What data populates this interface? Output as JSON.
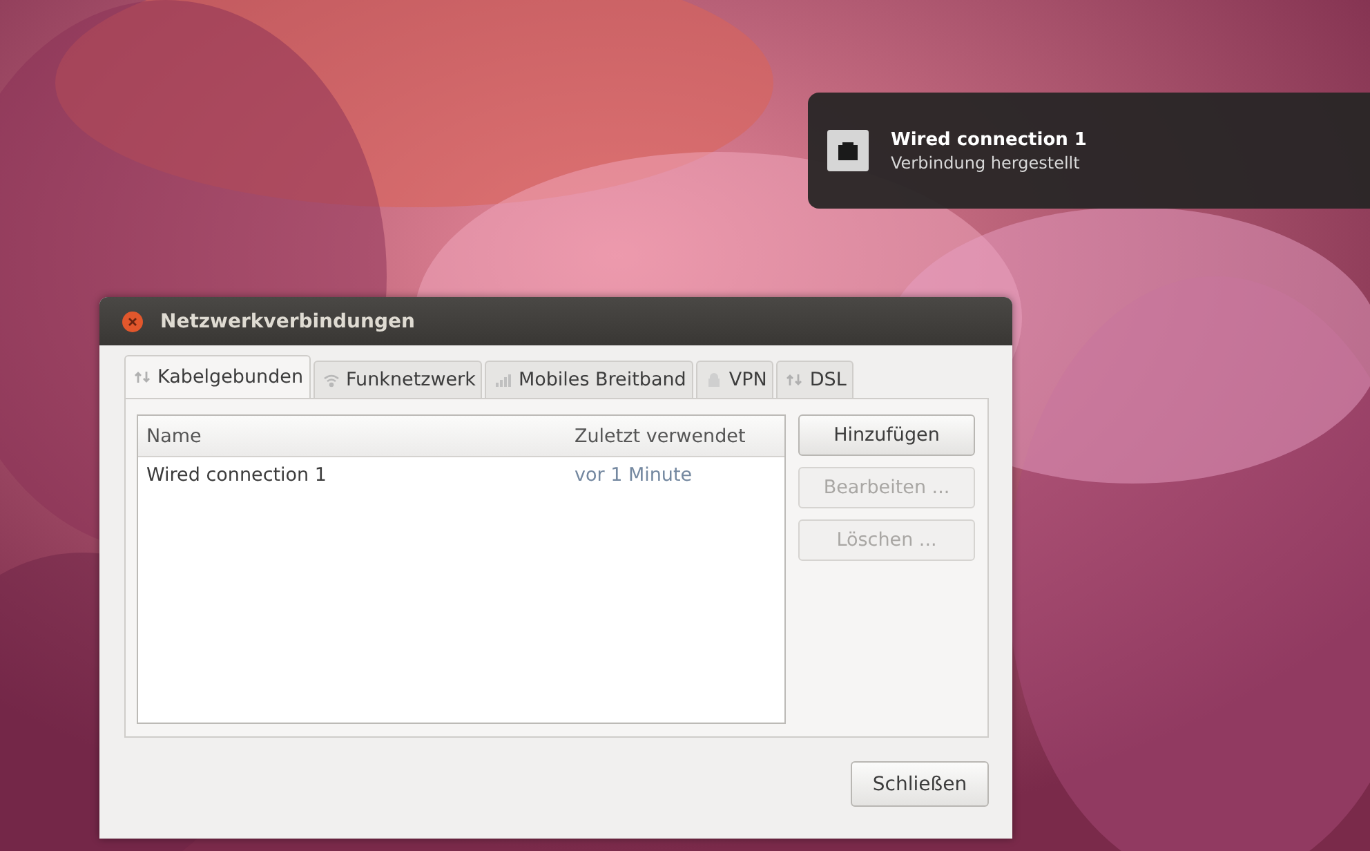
{
  "notification": {
    "title": "Wired connection 1",
    "body": "Verbindung hergestellt"
  },
  "window": {
    "title": "Netzwerkverbindungen"
  },
  "tabs": [
    {
      "label": "Kabelgebunden",
      "kind": "wired",
      "selected": true
    },
    {
      "label": "Funknetzwerk",
      "kind": "wireless",
      "selected": false
    },
    {
      "label": "Mobiles Breitband",
      "kind": "mobile",
      "selected": false
    },
    {
      "label": "VPN",
      "kind": "vpn",
      "selected": false
    },
    {
      "label": "DSL",
      "kind": "dsl",
      "selected": false
    }
  ],
  "table": {
    "columns": [
      "Name",
      "Zuletzt verwendet"
    ],
    "rows": [
      {
        "name": "Wired connection 1",
        "last_used": "vor 1 Minute"
      }
    ]
  },
  "side_buttons": [
    {
      "label": "Hinzufügen",
      "disabled": false
    },
    {
      "label": "Bearbeiten ...",
      "disabled": true
    },
    {
      "label": "Löschen ...",
      "disabled": true
    }
  ],
  "close_button": "Schließen"
}
